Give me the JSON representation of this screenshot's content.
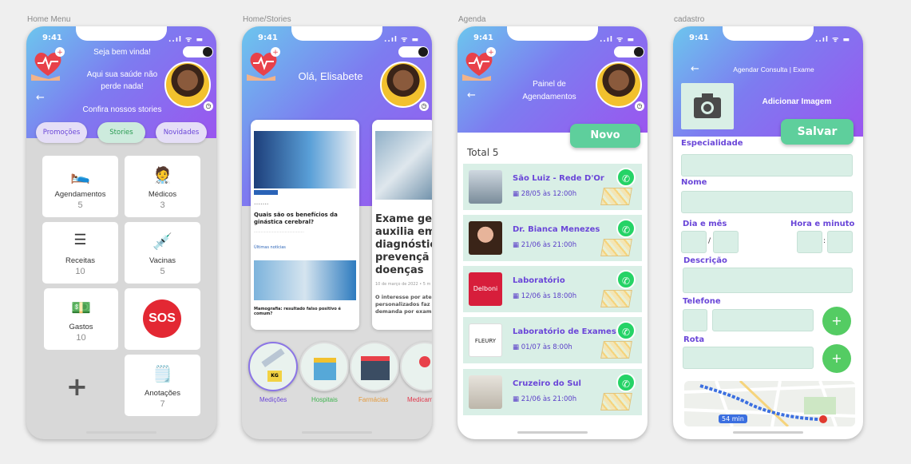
{
  "frames": {
    "home": "Home Menu",
    "stories": "Home/Stories",
    "agenda": "Agenda",
    "cadastro": "cadastro"
  },
  "status": {
    "time": "9:41",
    "signal": "..ıl ᯤ ▬"
  },
  "home": {
    "welcome": "Seja bem vinda!",
    "line1": "Aqui sua saúde não",
    "line2": "perde nada!",
    "stories_cta": "Confira nossos stories",
    "pills": [
      "Promoções",
      "Stories",
      "Novidades"
    ],
    "tiles": [
      {
        "label": "Agendamentos",
        "count": "5",
        "icon": "stretcher-icon"
      },
      {
        "label": "Médicos",
        "count": "3",
        "icon": "doctor-icon"
      },
      {
        "label": "Receitas",
        "count": "10",
        "icon": "prescription-icon"
      },
      {
        "label": "Vacinas",
        "count": "5",
        "icon": "vaccine-icon"
      },
      {
        "label": "Gastos",
        "count": "10",
        "icon": "money-icon"
      },
      {
        "label": "",
        "count": "",
        "icon": "sos-icon"
      },
      {
        "label": "",
        "count": "",
        "icon": "plus-icon"
      },
      {
        "label": "Anotações",
        "count": "7",
        "icon": "sticky-note-icon"
      }
    ],
    "sos": "SOS"
  },
  "stories": {
    "greeting": "Olá, Elisabete",
    "card1": {
      "title": "Quais são os benefícios da ginástica cerebral?",
      "section": "Últimas notícias",
      "title2": "Mamografia: resultado falso positivo é comum?"
    },
    "card2": {
      "title": "Exame gen auxilia em diagnóstic prevençã doenças",
      "date": "10 de março de 2022 • 5 m",
      "excerpt": "O interesse por aten personalizados faz c demanda por exam"
    },
    "categories": [
      {
        "label": "Medições",
        "color": "#6a46d8",
        "badge": "KG"
      },
      {
        "label": "Hospitais",
        "color": "#3fb34f"
      },
      {
        "label": "Farmácias",
        "color": "#e59a3b"
      },
      {
        "label": "Medicam",
        "color": "#e0374a"
      }
    ]
  },
  "agenda": {
    "title1": "Painel de",
    "title2": "Agendamentos",
    "new_button": "Novo",
    "total_label": "Total",
    "total_value": "5",
    "items": [
      {
        "name": "São Luiz - Rede D'Or",
        "date": "28/05 às 12:00h"
      },
      {
        "name": "Dr. Bianca Menezes",
        "date": "21/06 às 21:00h"
      },
      {
        "name": "Laboratório",
        "date": "12/06 às 18:00h",
        "logo": "Delboni"
      },
      {
        "name": "Laboratório de Exames",
        "date": "01/07 às 8:00h",
        "logo": "FLEURY"
      },
      {
        "name": "Cruzeiro do Sul",
        "date": "21/06 às 21:00h"
      }
    ]
  },
  "cadastro": {
    "header": "Agendar Consulta | Exame",
    "add_image": "Adicionar Imagem",
    "save": "Salvar",
    "especialidade": "Especialidade",
    "nome": "Nome",
    "dia_mes": "Dia e mês",
    "hora_minuto": "Hora e minuto",
    "descricao": "Descrição",
    "telefone": "Telefone",
    "rota": "Rota",
    "map_time": "54 min",
    "plus": "+"
  }
}
